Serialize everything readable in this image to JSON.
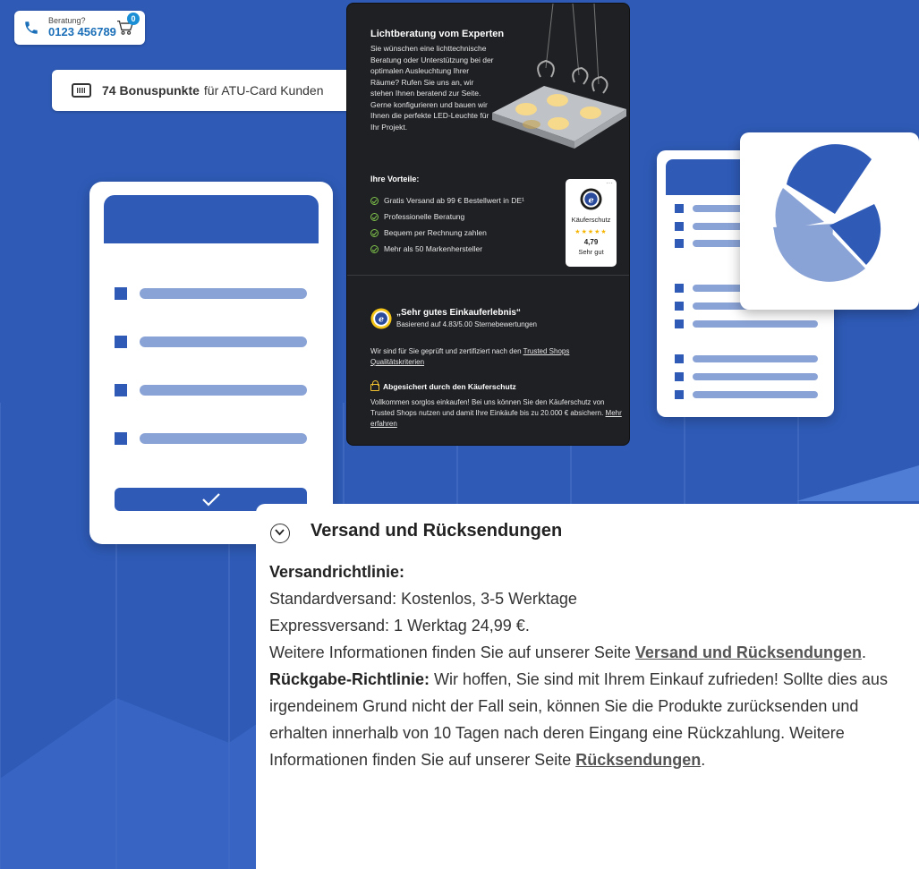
{
  "colors": {
    "background": "#2f5bb7",
    "accent_light": "#8aa3d6",
    "lamp_panel_bg": "#1f2024",
    "check_green": "#7ec24a",
    "link_blue": "#1b6fb8",
    "star_gold": "#f5b400"
  },
  "header": {
    "beratung_label": "Beratung?",
    "phone_number": "0123 456789",
    "cart_count": "0",
    "phone_icon": "phone-icon",
    "cart_icon": "shopping-cart-icon"
  },
  "bonus": {
    "icon": "card-icon",
    "points": "74 Bonuspunkte",
    "suffix": "für ATU-Card Kunden"
  },
  "lamp_panel": {
    "title": "Lichtberatung vom Experten",
    "description": "Sie wünschen eine lichttechnische Beratung oder Unterstützung bei der optimalen Ausleuchtung Ihrer Räume? Rufen Sie uns an, wir stehen Ihnen beratend zur Seite. Gerne konfigurieren und bauen wir Ihnen die perfekte LED-Leuchte für Ihr Projekt.",
    "benefits_heading": "Ihre Vorteile:",
    "benefits": [
      "Gratis Versand ab 99 € Bestellwert in DE¹",
      "Professionelle Beratung",
      "Bequem per Rechnung zahlen",
      "Mehr als 50 Markenhersteller"
    ],
    "trusted_badge": {
      "label": "Käuferschutz",
      "stars": "★★★★★",
      "score": "4,79",
      "rating_text": "Sehr gut",
      "menu": "···"
    },
    "quote": "„Sehr gutes Einkauferlebnis“",
    "based_on": "Basierend auf 4.83/5.00 Sternebewertungen",
    "certified_prefix": "Wir sind für Sie geprüft und zertifiziert nach den ",
    "certified_link": "Trusted Shops Qualitätskriterien",
    "secured_heading": "Abgesichert durch den Käuferschutz",
    "secured_text": "Vollkommen sorglos einkaufen! Bei uns können Sie den Käuferschutz von Trusted Shops nutzen und damit Ihre Einkäufe bis zu 20.000 € absichern. ",
    "secured_link": "Mehr erfahren"
  },
  "shipping": {
    "title": "Versand und Rücksendungen",
    "policy_heading": "Versandrichtlinie:",
    "standard": "Standardversand: Kostenlos, 3-5 Werktage",
    "express": "Expressversand: 1 Werktag 24,99 €.",
    "more_info_prefix": "Weitere Informationen finden Sie auf unserer Seite ",
    "more_info_link": "Versand und Rücksendungen",
    "more_info_suffix": ".",
    "return_heading": "Rückgabe-Richtlinie:",
    "return_text": " Wir hoffen, Sie sind mit Ihrem Einkauf zufrieden! Sollte dies aus irgendeinem Grund nicht der Fall sein, können Sie die Produkte zurücksenden und erhalten innerhalb von 10 Tagen nach deren Eingang eine Rückzahlung. Weitere Informationen finden Sie auf unserer Seite ",
    "return_link": "Rücksendungen",
    "return_suffix": "."
  }
}
